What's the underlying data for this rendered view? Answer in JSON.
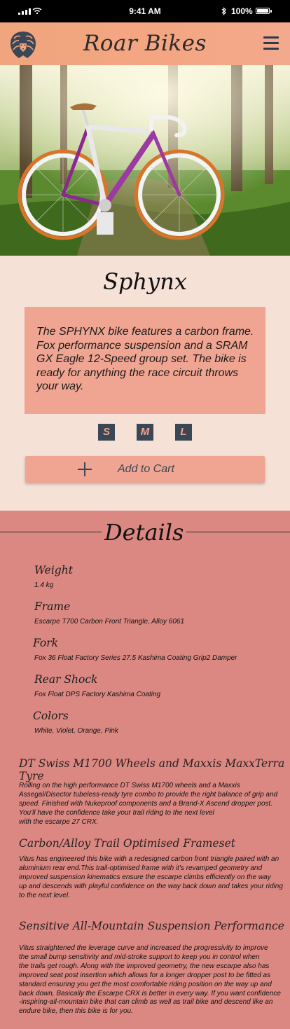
{
  "status_bar": {
    "time": "9:41 AM",
    "battery": "100%"
  },
  "header": {
    "brand": "Roar Bikes",
    "logo_icon": "lion-head-icon",
    "menu_icon": "hamburger-menu-icon"
  },
  "hero": {
    "image": "purple-white-fixie-bicycle-on-forest-path"
  },
  "product": {
    "name": "Sphynx",
    "description": "The SPHYNX bike features a carbon frame. Fox performance suspension and a SRAM GX Eagle 12-Speed group set. The bike is ready for anything the race circuit throws your way.",
    "sizes": [
      "S",
      "M",
      "L"
    ],
    "add_to_cart": "Add to Cart"
  },
  "details": {
    "heading": "Details",
    "specs": [
      {
        "label": "Weight",
        "value": "1.4 kg"
      },
      {
        "label": "Frame",
        "value": "Escarpe T700 Carbon Front Triangle, Alloy 6061"
      },
      {
        "label": "Fork",
        "value": "Fox 36 Float Factory Series 27.5 Kashima Coating Grip2 Damper"
      },
      {
        "label": "Rear Shock",
        "value": "Fox Float DPS Factory Kashima Coating"
      },
      {
        "label": "Colors",
        "value": "White, Violet, Orange, Pink"
      }
    ],
    "features": [
      {
        "title": "DT Swiss M1700 Wheels and Maxxis MaxxTerra Tyre",
        "lines": [
          "Rolling on the high performance DT Swiss M1700 wheels and  a Maxxis",
          "Assegal/Disector tubeless-ready tyre combo to provide the right balance of grip and",
          "speed. Finished with Nukeproof components and a Brand-X Ascend dropper post.",
          "You'll have the confidence take your trail riding to the next level",
          "with the escarpe 27 CRX."
        ]
      },
      {
        "title": "Carbon/Alloy Trail Optimised Frameset",
        "lines": [
          "Vitus has engineered this bike with a redesigned carbon front triangle paired with an",
          "aluminium rear end.This trail-optimised frame with it's revamped geometry and",
          "improved suspension kinematics ensure the escarpe climbs efficiently on the way",
          "up and descends with playful confidence on the way back down and takes your riding",
          "to the next level."
        ]
      },
      {
        "title": "Sensitive All-Mountain Suspension Performance",
        "lines": [
          "Vitus straightened the leverage curve and increased the progressivity to improve",
          "the small bump  sensitivity and mid-stroke support to keep you in control when",
          "the trails get rough. Along with the improved geometry, the new escarpe also has",
          "improved seat post insertion which allows for a longer dropper post to be fitted as",
          "standard ensuring you get the most comfortable riding position on the way up and",
          "back down, Basically the Escarpe CRX is better in every way. If you want confidence",
          "-inspiring-all-mountain bike that can climb as well as trail bike and descend like an",
          "endure bike, then this bike is for you."
        ]
      }
    ]
  }
}
